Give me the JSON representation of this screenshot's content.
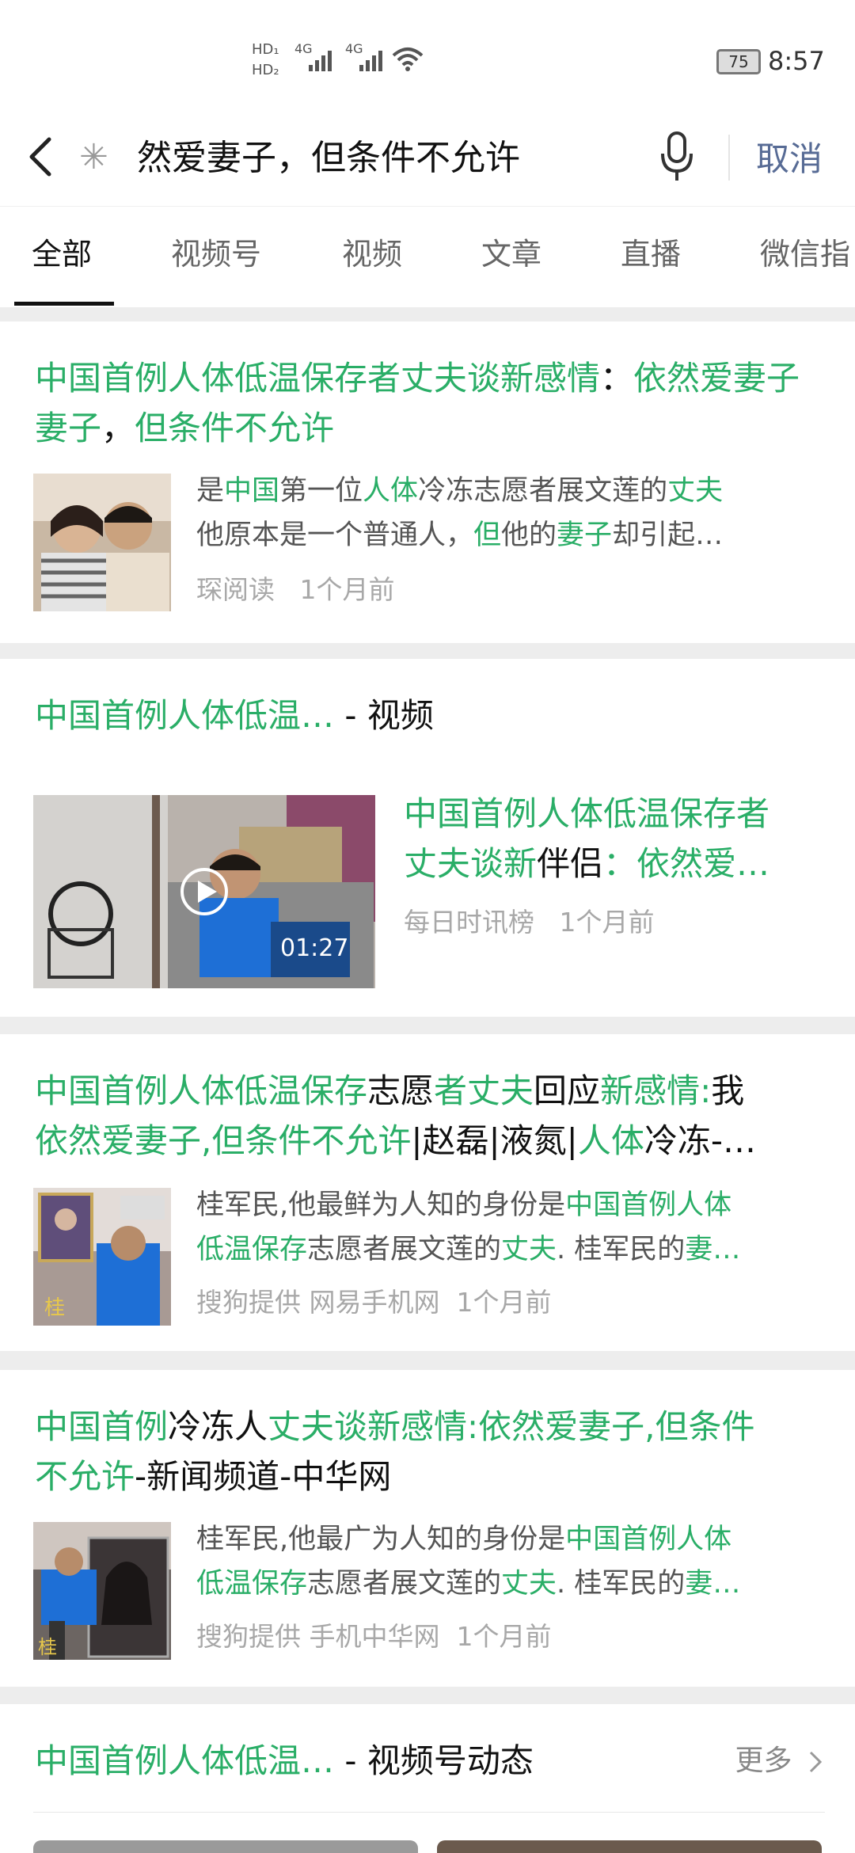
{
  "status_bar": {
    "hd1": "HD₁",
    "hd2": "HD₂",
    "net1": "4G",
    "net2": "4G",
    "battery": "75",
    "time": "8:57"
  },
  "search": {
    "query": "然爱妻子，但条件不允许",
    "cancel_label": "取消"
  },
  "tabs": [
    {
      "label": "全部",
      "active": true
    },
    {
      "label": "视频号"
    },
    {
      "label": "视频"
    },
    {
      "label": "文章"
    },
    {
      "label": "直播"
    },
    {
      "label": "微信指"
    }
  ],
  "results": [
    {
      "title_parts": [
        "中国首例人体低温保存者丈夫谈新感情",
        "：",
        "依然爱妻子",
        "，",
        "但条件不允许"
      ],
      "desc_line1_parts": [
        "是",
        "中国",
        "第一位",
        "人体",
        "冷冻志愿者展文莲的",
        "丈夫"
      ],
      "desc_line2_parts": [
        "他原本是一个普通人，",
        "但",
        "他的",
        "妻子",
        "却引起…"
      ],
      "source": "琛阅读",
      "time": "1个月前"
    },
    {
      "section_title": "中国首例人体低温…",
      "section_suffix": " - 视频",
      "video_title_line1": "中国首例人体低温保存者",
      "video_title_line2_parts": [
        "丈夫谈新",
        "伴侣",
        "：",
        "依然爱…"
      ],
      "duration": "01:27",
      "source": "每日时讯榜",
      "time": "1个月前"
    },
    {
      "title_line1_parts": [
        "中国首例人体低温保存",
        "志愿",
        "者丈夫",
        "回应",
        "新感情:",
        "我"
      ],
      "title_line2_parts": [
        "依然爱妻子,但条件不允许",
        "|赵磊|液氮|",
        "人体",
        "冷冻-…"
      ],
      "desc_line1_parts": [
        "桂军民,他最鲜为人知的身份是",
        "中国首例人体"
      ],
      "desc_line2_parts": [
        "低温保存",
        "志愿者展文莲的",
        "丈夫",
        ". 桂军民的",
        "妻…"
      ],
      "source": "搜狗提供 网易手机网",
      "time": "1个月前"
    },
    {
      "title_line1_parts": [
        "中国首例",
        "冷冻人",
        "丈夫谈新感情:依然爱妻子,但条件"
      ],
      "title_line2_parts": [
        "不允许",
        "-新闻频道-中华网"
      ],
      "desc_line1_parts": [
        "桂军民,他最广为人知的身份是",
        "中国首例人体"
      ],
      "desc_line2_parts": [
        "低温保存",
        "志愿者展文莲的",
        "丈夫",
        ". 桂军民的",
        "妻…"
      ],
      "source": "搜狗提供 手机中华网",
      "time": "1个月前"
    },
    {
      "section_title": "中国首例人体低温…",
      "section_suffix": " - 视频号动态",
      "more_label": "更多"
    }
  ],
  "colors": {
    "highlight": "#2aae67",
    "cancel": "#576b95"
  }
}
